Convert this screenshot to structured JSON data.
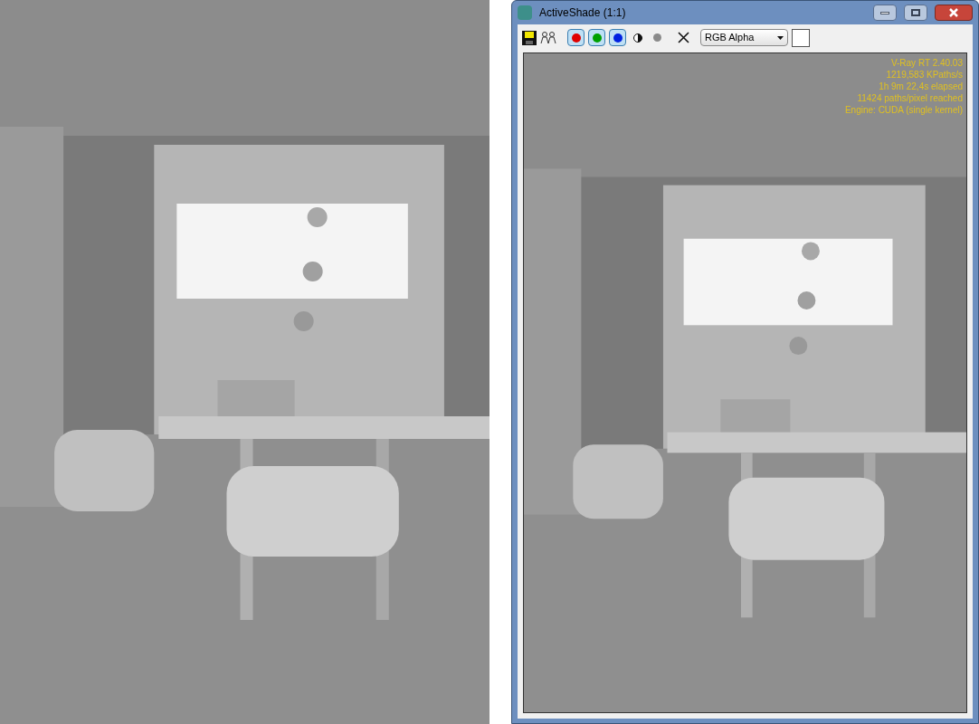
{
  "window": {
    "title": "ActiveShade (1:1)"
  },
  "toolbar": {
    "channels": [
      {
        "color": "#e00000",
        "selected": true
      },
      {
        "color": "#00a000",
        "selected": true
      },
      {
        "color": "#0020e0",
        "selected": true
      }
    ],
    "display_mode": {
      "value": "RGB Alpha"
    }
  },
  "render_view": {
    "kind": "picture",
    "overlay_lines": [
      "V-Ray RT 2.40.03",
      "1219,583 KPaths/s",
      "1h 9m 22,4s elapsed",
      "11424 paths/pixel reached",
      "Engine: CUDA (single kernel)"
    ]
  }
}
